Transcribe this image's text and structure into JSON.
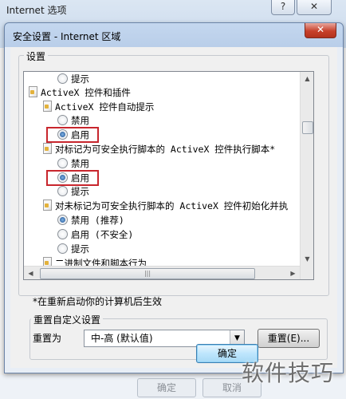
{
  "outer_window": {
    "title": "Internet 选项",
    "help_label": "?",
    "close_label": "✕",
    "bottom_buttons": [
      "确定",
      "取消"
    ]
  },
  "dialog": {
    "title": "安全设置 - Internet 区域",
    "close_label": "✕",
    "settings_group_label": "设置",
    "tree": [
      {
        "kind": "radio",
        "label": "提示",
        "checked": false
      },
      {
        "kind": "category",
        "label": "ActiveX 控件和插件"
      },
      {
        "kind": "setting",
        "label": "ActiveX 控件自动提示"
      },
      {
        "kind": "radio",
        "label": "禁用",
        "checked": false
      },
      {
        "kind": "radio",
        "label": "启用",
        "checked": true,
        "highlighted": true
      },
      {
        "kind": "setting",
        "label": "对标记为可安全执行脚本的 ActiveX 控件执行脚本*"
      },
      {
        "kind": "radio",
        "label": "禁用",
        "checked": false
      },
      {
        "kind": "radio",
        "label": "启用",
        "checked": true,
        "highlighted": true
      },
      {
        "kind": "radio",
        "label": "提示",
        "checked": false
      },
      {
        "kind": "setting",
        "label": "对未标记为可安全执行脚本的 ActiveX 控件初始化并执"
      },
      {
        "kind": "radio",
        "label": "禁用 (推荐)",
        "checked": true
      },
      {
        "kind": "radio",
        "label": "启用 (不安全)",
        "checked": false
      },
      {
        "kind": "radio",
        "label": "提示",
        "checked": false
      },
      {
        "kind": "setting",
        "label": "二进制文件和脚本行为"
      }
    ],
    "footnote": "*在重新启动你的计算机后生效",
    "reset_group_label": "重置自定义设置",
    "reset_to_label": "重置为",
    "reset_level_value": "中-高 (默认值)",
    "reset_button": "重置(E)...",
    "ok_button": "确定"
  },
  "watermark": "软件技巧",
  "colors": {
    "highlight": "#c8262d",
    "accent": "#3c7fb1"
  }
}
